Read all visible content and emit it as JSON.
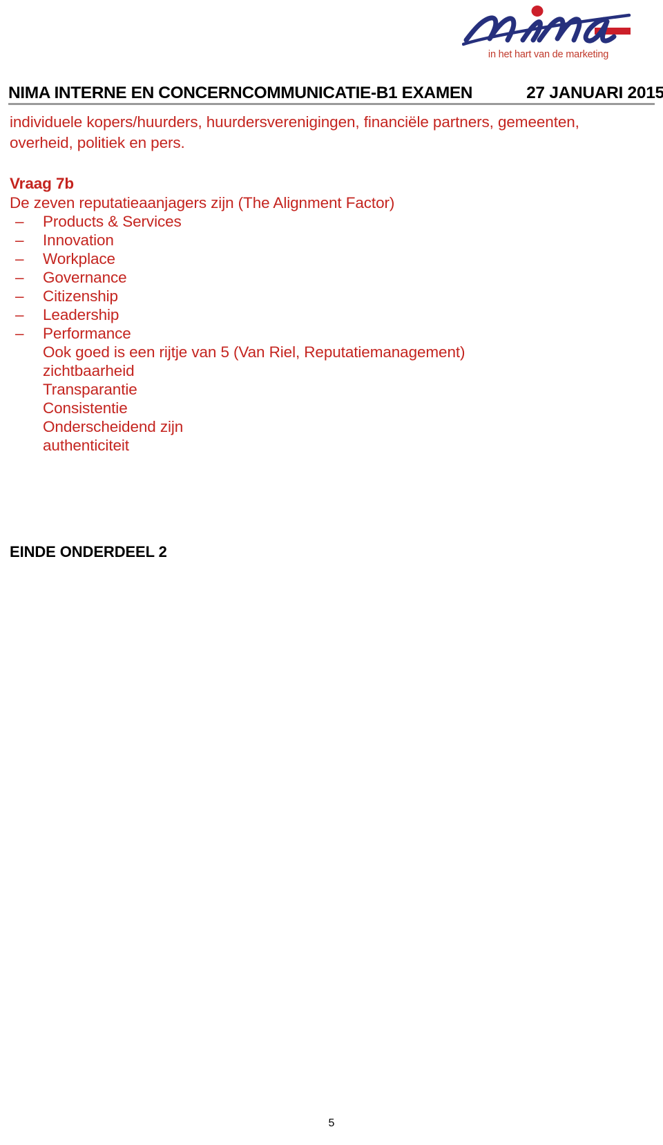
{
  "document": {
    "background_color": "#ffffff",
    "body_text_color": "#C4241F",
    "header_text_color": "#000000",
    "logo_blue": "#26307D",
    "logo_red": "#CC1F2A"
  },
  "logo": {
    "mark_name": "nima-logo",
    "wordmark": "nima",
    "tagline": "in het hart van de marketing"
  },
  "header": {
    "title": "NIMA INTERNE EN CONCERNCOMMUNICATIE-B1 EXAMEN",
    "date": "27 JANUARI 2015"
  },
  "body": {
    "intro_paragraph": "individuele kopers/huurders, huurdersverenigingen, financiële partners, gemeenten, overheid, politiek en pers.",
    "question_label": "Vraag 7b",
    "lead_line": "De zeven reputatieaanjagers zijn (The Alignment Factor)",
    "bullet_marker": "–",
    "drivers": [
      "Products & Services",
      "Innovation",
      "Workplace",
      "Governance",
      "Citizenship",
      "Leadership",
      "Performance"
    ],
    "alternative_intro": "Ook goed is een rijtje van 5 (Van Riel, Reputatiemanagement)",
    "alternative_items": [
      "zichtbaarheid",
      "Transparantie",
      "Consistentie",
      "Onderscheidend zijn",
      "authenticiteit"
    ]
  },
  "footer": {
    "end_notice": "EINDE ONDERDEEL 2",
    "page_number": "5"
  }
}
